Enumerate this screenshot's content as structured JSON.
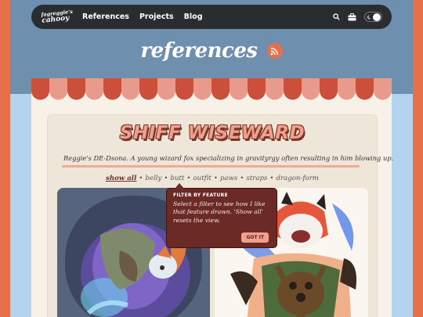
{
  "nav": {
    "logo_line1": "fagreggie's",
    "logo_line2": "cahooy",
    "links": [
      "References",
      "Projects",
      "Blog"
    ],
    "icons": [
      "search-icon",
      "briefcase-icon",
      "theme-toggle"
    ]
  },
  "page": {
    "title": "references",
    "rss_icon": "rss-icon"
  },
  "character": {
    "name": "SHIFF WISEWARD",
    "description": "Reggie's DE-Dsona. A young wizard fox specializing in gravityrgy often resulting in him blowing up."
  },
  "filters": {
    "items": [
      "show all",
      "belly",
      "butt",
      "outfit",
      "paws",
      "straps",
      "dragon-form"
    ],
    "active": "show all",
    "separator": "•"
  },
  "tooltip": {
    "title": "FILTER BY FEATURE",
    "body": "Select a filter to see how I like that feature drawn. 'Show all' resets the view.",
    "button": "GOT IT"
  },
  "colors": {
    "accent": "#e5714a",
    "nav_bg": "#2a2d30",
    "tooltip_bg": "#6b2a25",
    "awning_red": "#cc4f3c",
    "awning_pink": "#e89a8c"
  }
}
